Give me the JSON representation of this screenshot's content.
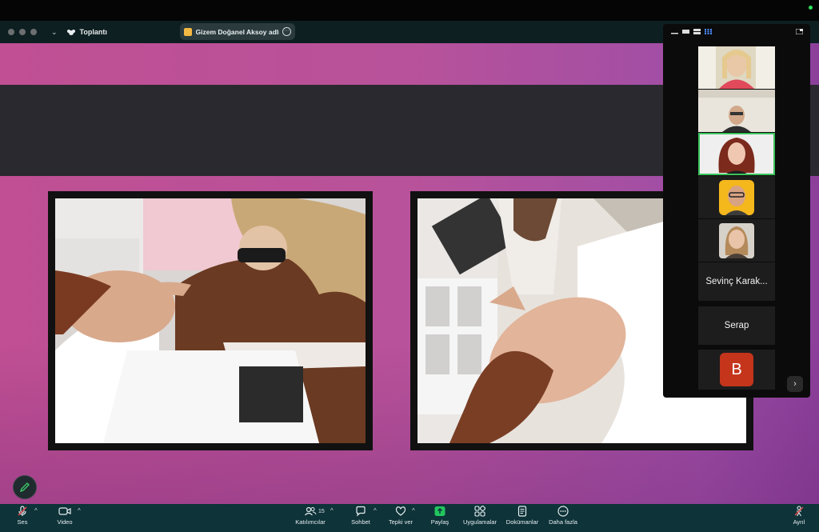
{
  "window": {
    "app_title": "Toplantı",
    "tab_label": "Gizem Doğanel Aksoy adlı kişi"
  },
  "gallery": {
    "participants": [
      {
        "type": "video"
      },
      {
        "type": "video"
      },
      {
        "type": "video",
        "active": true
      },
      {
        "type": "photo"
      },
      {
        "type": "photo"
      },
      {
        "type": "name",
        "label": "Sevinç Karak..."
      },
      {
        "type": "name",
        "label": "Serap"
      },
      {
        "type": "avatar",
        "initial": "B",
        "color": "#c4351c"
      }
    ],
    "next_label": "›"
  },
  "toolbar": {
    "audio": "Ses",
    "video": "Video",
    "participants": "Katılımcılar",
    "participants_count": "15",
    "chat": "Sohbet",
    "react": "Tepki ver",
    "share": "Paylaş",
    "apps": "Uygulamalar",
    "docs": "Dokümanlar",
    "more": "Daha fazla",
    "leave": "Ayrıl"
  },
  "colors": {
    "share_accent": "#22c55e",
    "toolbar_bg": "#0e3339",
    "active_speaker": "#3cc45c"
  }
}
